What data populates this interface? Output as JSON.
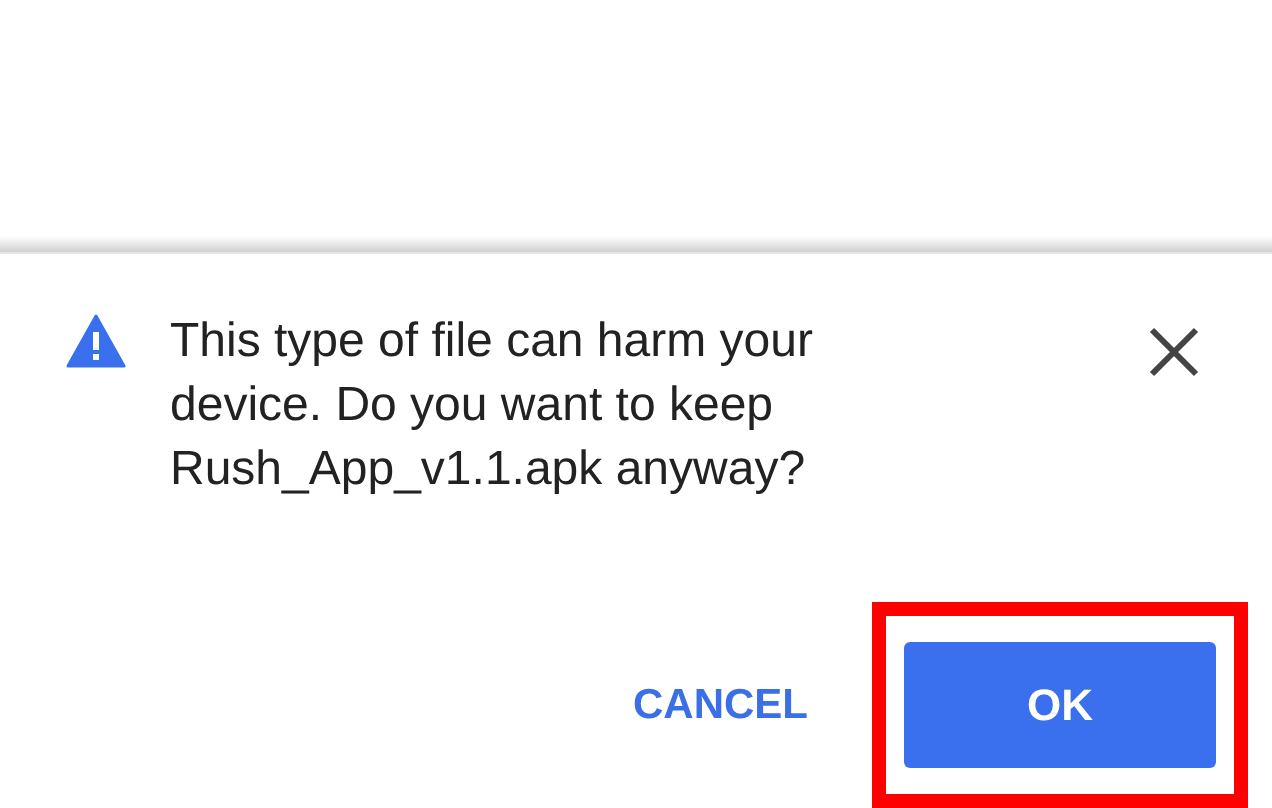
{
  "dialog": {
    "message": "This type of file can harm your device. Do you want to keep Rush_App_v1.1.apk anyway?",
    "buttons": [
      {
        "label": "CANCEL",
        "kind": "text",
        "highlighted": false
      },
      {
        "label": "OK",
        "kind": "filled",
        "highlighted": true
      }
    ]
  }
}
